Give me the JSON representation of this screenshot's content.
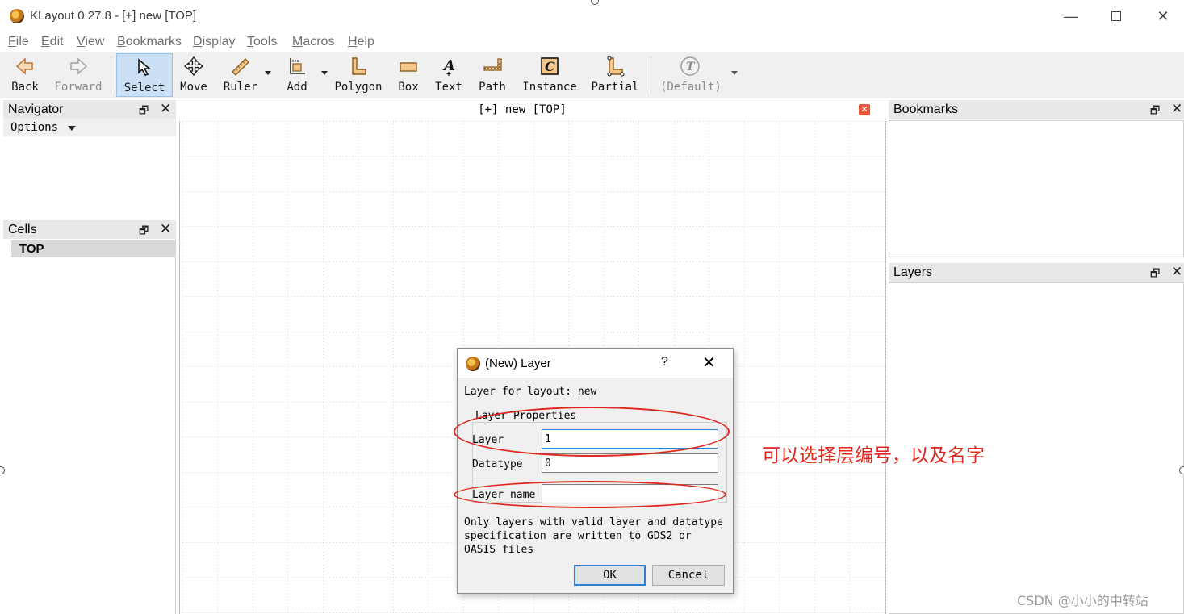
{
  "window": {
    "title": "KLayout 0.27.8 - [+] new [TOP]",
    "min_glyph": "—",
    "close_glyph": "✕",
    "app_icon": "klayout-logo-icon"
  },
  "menu": [
    {
      "label": "File",
      "u": "F",
      "rest": "ile"
    },
    {
      "label": "Edit",
      "u": "E",
      "rest": "dit"
    },
    {
      "label": "View",
      "u": "V",
      "rest": "iew"
    },
    {
      "label": "Bookmarks",
      "u": "B",
      "rest": "ookmarks"
    },
    {
      "label": "Display",
      "u": "D",
      "rest": "isplay"
    },
    {
      "label": "Tools",
      "u": "T",
      "rest": "ools"
    },
    {
      "label": "Macros",
      "u": "M",
      "rest": "acros"
    },
    {
      "label": "Help",
      "u": "H",
      "rest": "elp"
    }
  ],
  "toolbar": {
    "back": "Back",
    "forward": "Forward",
    "select": "Select",
    "move": "Move",
    "ruler": "Ruler",
    "add": "Add",
    "polygon": "Polygon",
    "box": "Box",
    "text": "Text",
    "path": "Path",
    "instance": "Instance",
    "partial": "Partial",
    "default": "(Default)"
  },
  "navigator": {
    "title": "Navigator",
    "options": "Options"
  },
  "cells": {
    "title": "Cells",
    "top": "TOP"
  },
  "canvas": {
    "tab_title": "[+] new [TOP]",
    "close_glyph": "✕"
  },
  "bookmarks": {
    "title": "Bookmarks"
  },
  "layers": {
    "title": "Layers"
  },
  "dock_glyphs": {
    "float": "🗗",
    "close": "✕"
  },
  "dialog": {
    "title": "(New) Layer",
    "help": "?",
    "close": "✕",
    "layout_label": "Layer for layout: new",
    "group_title": "Layer Properties",
    "layer_label": "Layer",
    "layer_value": "1",
    "datatype_label": "Datatype",
    "datatype_value": "0",
    "name_label": "Layer name",
    "name_value": "",
    "note_line1": "Only layers with valid layer and datatype",
    "note_line2": "specification are written to GDS2 or",
    "note_line3": "OASIS files",
    "ok": "OK",
    "cancel": "Cancel"
  },
  "annotation": {
    "text": "可以选择层编号，以及名字",
    "color": "#e0261c"
  },
  "watermark": "CSDN @小小的中转站"
}
